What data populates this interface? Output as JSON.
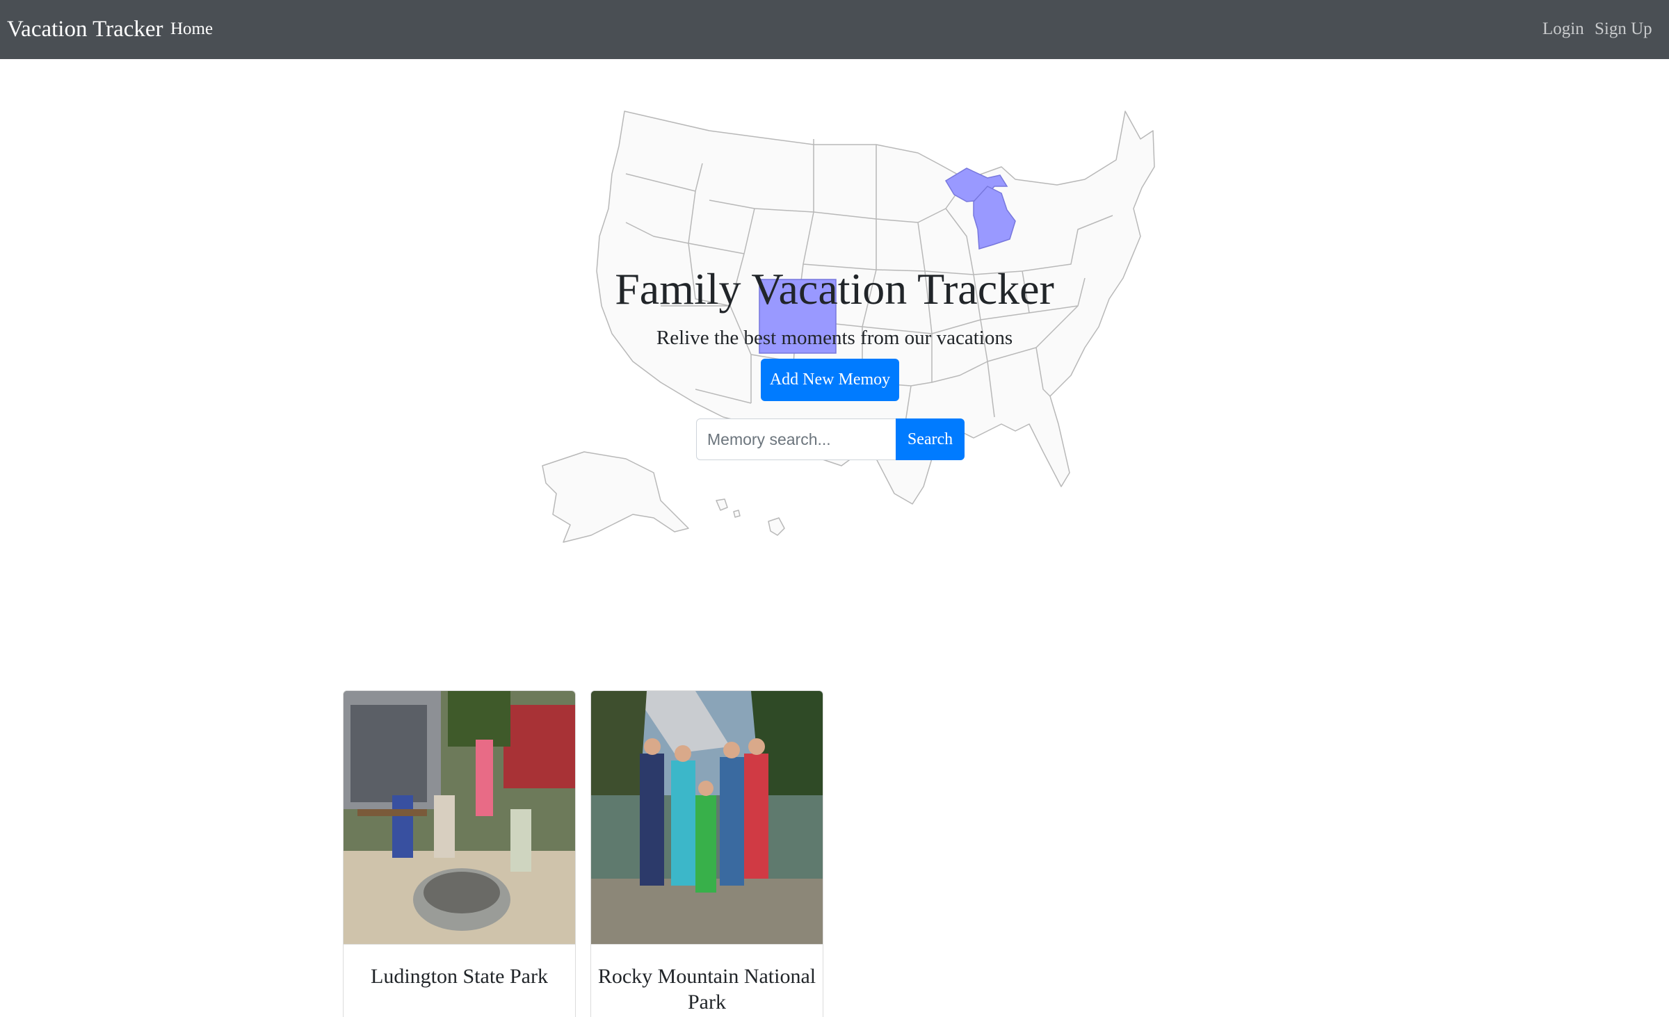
{
  "navbar": {
    "brand": "Vacation Tracker",
    "home": "Home",
    "login": "Login",
    "signup": "Sign Up"
  },
  "hero": {
    "title": "Family Vacation Tracker",
    "subtitle": "Relive the best moments from our vacations",
    "add_button": "Add New Memoy",
    "search_placeholder": "Memory search...",
    "search_button": "Search",
    "highlighted_states": [
      "Michigan",
      "Colorado"
    ],
    "highlight_color": "#9999ff"
  },
  "cards": [
    {
      "title": "Ludington State Park"
    },
    {
      "title": "Rocky Mountain National Park"
    }
  ],
  "colors": {
    "navbar": "#4a4f54",
    "primary": "#007bff"
  }
}
